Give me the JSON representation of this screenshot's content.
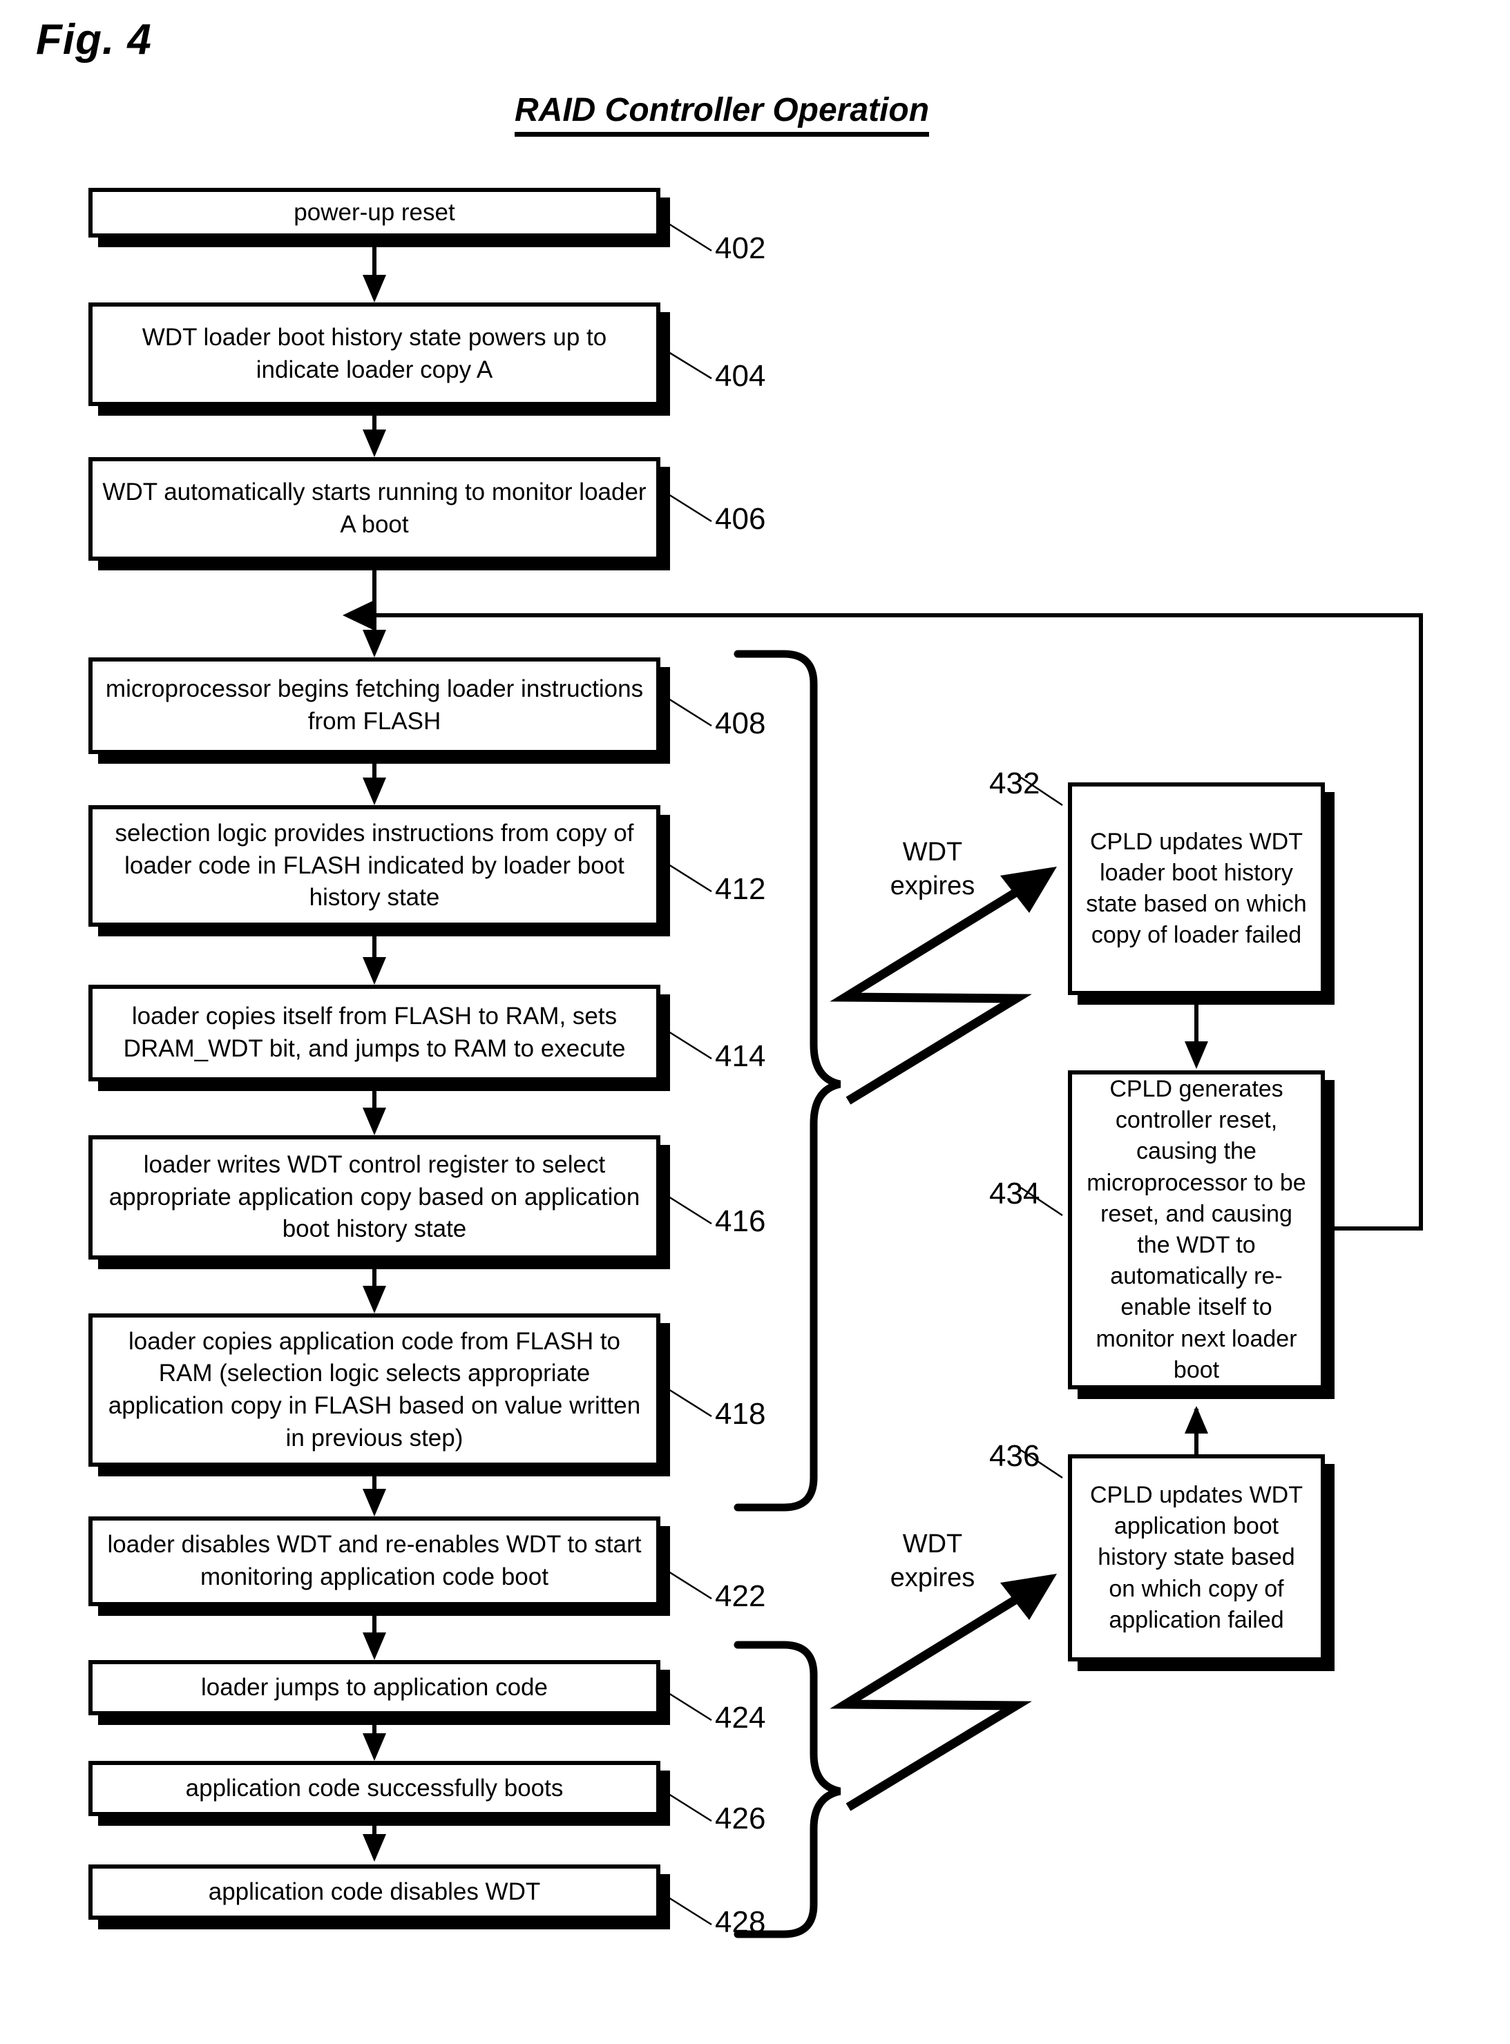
{
  "figure": {
    "label": "Fig. 4",
    "title": "RAID Controller Operation"
  },
  "flow": {
    "main_steps": [
      {
        "ref": "402",
        "text": "power-up reset"
      },
      {
        "ref": "404",
        "text": "WDT loader boot history state powers up to indicate loader copy A"
      },
      {
        "ref": "406",
        "text": "WDT automatically starts running to monitor loader A boot"
      },
      {
        "ref": "408",
        "text": "microprocessor begins fetching loader instructions from FLASH"
      },
      {
        "ref": "412",
        "text": "selection logic provides instructions from copy of loader code in FLASH indicated by loader boot history state"
      },
      {
        "ref": "414",
        "text": "loader copies itself from FLASH to RAM, sets DRAM_WDT bit, and jumps to RAM to execute"
      },
      {
        "ref": "416",
        "text": "loader writes WDT control register to select appropriate application copy based on application boot history state"
      },
      {
        "ref": "418",
        "text": "loader copies application code from FLASH to RAM (selection logic selects appropriate application copy in FLASH based on value written in previous step)"
      },
      {
        "ref": "422",
        "text": "loader disables WDT and re-enables WDT to start monitoring application code boot"
      },
      {
        "ref": "424",
        "text": "loader jumps to application code"
      },
      {
        "ref": "426",
        "text": "application code successfully boots"
      },
      {
        "ref": "428",
        "text": "application code disables WDT"
      }
    ],
    "fault_steps": [
      {
        "ref": "432",
        "text": "CPLD updates WDT loader boot history state based on which copy of loader failed"
      },
      {
        "ref": "434",
        "text": "CPLD generates controller reset, causing the microprocessor to be reset, and causing the WDT to automatically re-enable itself to monitor next loader boot"
      },
      {
        "ref": "436",
        "text": "CPLD updates WDT application boot history state based on which copy of application failed"
      }
    ],
    "annotations": [
      {
        "id": "wdt-expires-loader",
        "text": "WDT\nexpires"
      },
      {
        "id": "wdt-expires-application",
        "text": "WDT\nexpires"
      }
    ]
  },
  "style": {
    "ink": "#000000",
    "paper": "#ffffff"
  }
}
